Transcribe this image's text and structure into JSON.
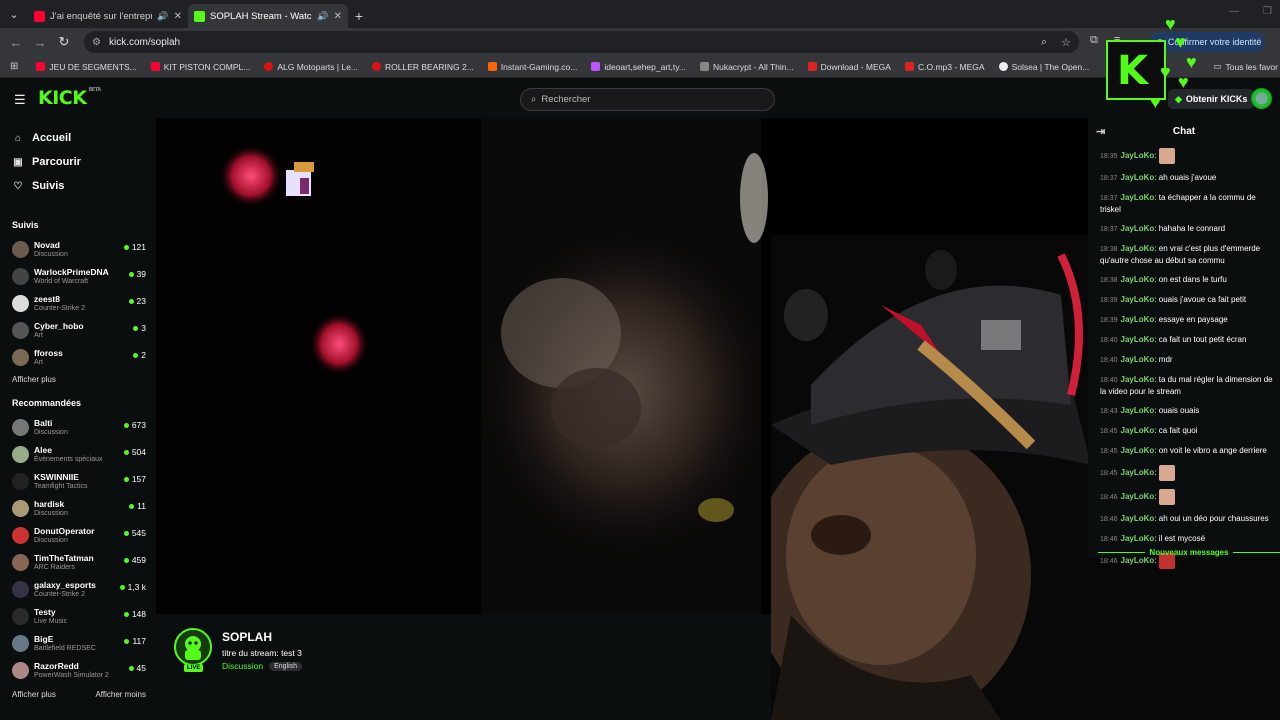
{
  "browser": {
    "tabs": [
      {
        "title": "J'ai enquêté sur l'entreprise",
        "favicon_color": "#ff0033",
        "active": false
      },
      {
        "title": "SOPLAH Stream - Watch Li...",
        "favicon_color": "#53fc18",
        "active": true
      }
    ],
    "address": "kick.com/soplah",
    "profile_label": "Confirmer votre identité",
    "bookmarks": [
      {
        "label": "JEU DE SEGMENTS...",
        "color": "#ff0033"
      },
      {
        "label": "KIT PISTON COMPL...",
        "color": "#ff0033"
      },
      {
        "label": "ALG Motoparts | Le...",
        "color": "#d11"
      },
      {
        "label": "ROLLER BEARING 2...",
        "color": "#d11"
      },
      {
        "label": "Instant-Gaming.co...",
        "color": "#f60"
      },
      {
        "label": "ideoart,sehep_art,ty...",
        "color": "#b5f"
      },
      {
        "label": "Nukacrypt - All Thin...",
        "color": "#888"
      },
      {
        "label": "Download - MEGA",
        "color": "#d22"
      },
      {
        "label": "C.O.mp3 - MEGA",
        "color": "#d22"
      },
      {
        "label": "Solsea | The Open...",
        "color": "#eee"
      },
      {
        "label": "Tous les favor",
        "color": "#aaa"
      }
    ]
  },
  "header": {
    "logo": "KICK",
    "beta": "BETA",
    "search_placeholder": "Rechercher",
    "kicks_button": "Obtenir KICKs"
  },
  "sidebar": {
    "nav": [
      {
        "label": "Accueil",
        "icon": "home-icon",
        "glyph": "⌂"
      },
      {
        "label": "Parcourir",
        "icon": "browse-icon",
        "glyph": "▣"
      },
      {
        "label": "Suivis",
        "icon": "heart-icon",
        "glyph": "♡"
      }
    ],
    "followed_title": "Suivis",
    "followed": [
      {
        "name": "Novad",
        "category": "Discussion",
        "viewers": "121",
        "color": "#6b5a4e"
      },
      {
        "name": "WarlockPrimeDNA",
        "category": "World of Warcraft",
        "viewers": "39",
        "color": "#444"
      },
      {
        "name": "zeest8",
        "category": "Counter-Strike 2",
        "viewers": "23",
        "color": "#ddd"
      },
      {
        "name": "Cyber_hobo",
        "category": "Art",
        "viewers": "3",
        "color": "#555"
      },
      {
        "name": "ffoross",
        "category": "Art",
        "viewers": "2",
        "color": "#7a6a55"
      }
    ],
    "show_more": "Afficher plus",
    "recommended_title": "Recommandées",
    "recommended": [
      {
        "name": "Balti",
        "category": "Discussion",
        "viewers": "673",
        "color": "#777"
      },
      {
        "name": "Alee",
        "category": "Évènements spéciaux",
        "viewers": "504",
        "color": "#9a8"
      },
      {
        "name": "KSWINNIIE",
        "category": "Teamfight Tactics",
        "viewers": "157",
        "color": "#222"
      },
      {
        "name": "hardisk",
        "category": "Discussion",
        "viewers": "11",
        "color": "#a97"
      },
      {
        "name": "DonutOperator",
        "category": "Discussion",
        "viewers": "545",
        "color": "#c33"
      },
      {
        "name": "TimTheTatman",
        "category": "ARC Raiders",
        "viewers": "459",
        "color": "#865"
      },
      {
        "name": "galaxy_esports",
        "category": "Counter-Strike 2",
        "viewers": "1,3 k",
        "color": "#334"
      },
      {
        "name": "Testy",
        "category": "Live Music",
        "viewers": "148",
        "color": "#2a2a2a"
      },
      {
        "name": "BigE",
        "category": "Battlefield REDSEC",
        "viewers": "117",
        "color": "#678"
      },
      {
        "name": "RazorRedd",
        "category": "PowerWash Simulator 2",
        "viewers": "45",
        "color": "#a88"
      }
    ],
    "show_more_2": "Afficher plus",
    "show_less": "Afficher moins"
  },
  "stream": {
    "channel": "SOPLAH",
    "live_badge": "LIVE",
    "title_label": "titre du stream:",
    "title_value": "test 3",
    "category": "Discussion",
    "language": "English"
  },
  "chat": {
    "title": "Chat",
    "messages": [
      {
        "time": "18:35",
        "user": "JayLoKo",
        "text": "",
        "emote": "#d8a890"
      },
      {
        "time": "18:37",
        "user": "JayLoKo",
        "text": "ah ouais j'avoue"
      },
      {
        "time": "18:37",
        "user": "JayLoKo",
        "text": "ta échapper a la commu de triskel"
      },
      {
        "time": "18:37",
        "user": "JayLoKo",
        "text": "hahaha le connard"
      },
      {
        "time": "18:38",
        "user": "JayLoKo",
        "text": "en vrai c'est plus d'emmerde qu'autre chose au début sa commu"
      },
      {
        "time": "18:38",
        "user": "JayLoKo",
        "text": "on est dans le turfu"
      },
      {
        "time": "18:39",
        "user": "JayLoKo",
        "text": "ouais j'avoue ca fait petit"
      },
      {
        "time": "18:39",
        "user": "JayLoKo",
        "text": "essaye en paysage"
      },
      {
        "time": "18:40",
        "user": "JayLoKo",
        "text": "ca fait un tout petit écran"
      },
      {
        "time": "18:40",
        "user": "JayLoKo",
        "text": "mdr"
      },
      {
        "time": "18:40",
        "user": "JayLoKo",
        "text": "ta du mal régler la dimension de la video pour le stream"
      },
      {
        "time": "18:43",
        "user": "JayLoKo",
        "text": "ouais ouais"
      },
      {
        "time": "18:45",
        "user": "JayLoKo",
        "text": "ca fait quoi"
      },
      {
        "time": "18:45",
        "user": "JayLoKo",
        "text": "on voit le vibro a ange derriere"
      },
      {
        "time": "18:45",
        "user": "JayLoKo",
        "text": "",
        "emote": "#d8a890"
      },
      {
        "time": "18:46",
        "user": "JayLoKo",
        "text": "",
        "emote": "#d8a890"
      },
      {
        "time": "18:46",
        "user": "JayLoKo",
        "text": "ah oui un déo pour chaussures"
      },
      {
        "time": "18:46",
        "user": "JayLoKo",
        "text": "il est mycosé"
      },
      {
        "time": "18:46",
        "user": "JayLoKo",
        "text": "",
        "emote": "#c03030"
      }
    ],
    "new_messages": "Nouveaux messages"
  },
  "colors": {
    "accent": "#53fc18",
    "background": "#0b0e0f",
    "username": "#7ad36a"
  }
}
